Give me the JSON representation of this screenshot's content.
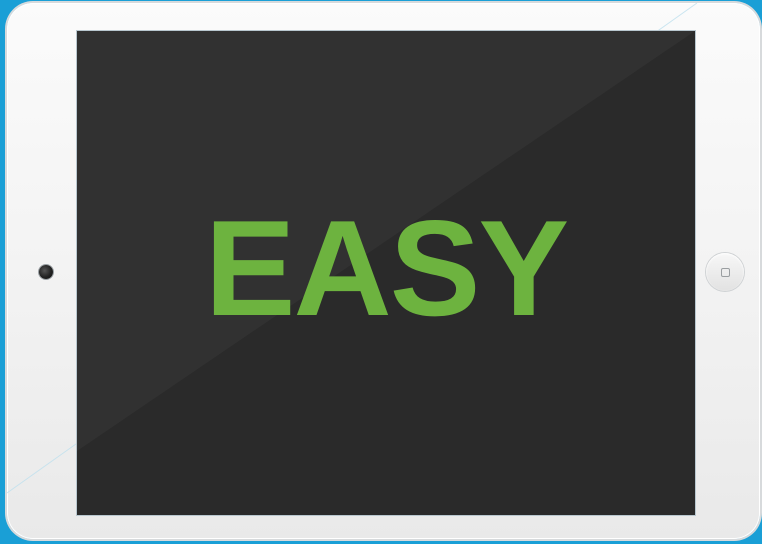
{
  "screen": {
    "text": "EASY"
  },
  "icons": {
    "camera": "camera-icon",
    "home": "home-square-icon"
  },
  "colors": {
    "background": "#1a9fd6",
    "bezel": "#f2f2f2",
    "screen": "#2a2a2a",
    "text_accent": "#6db33f"
  }
}
